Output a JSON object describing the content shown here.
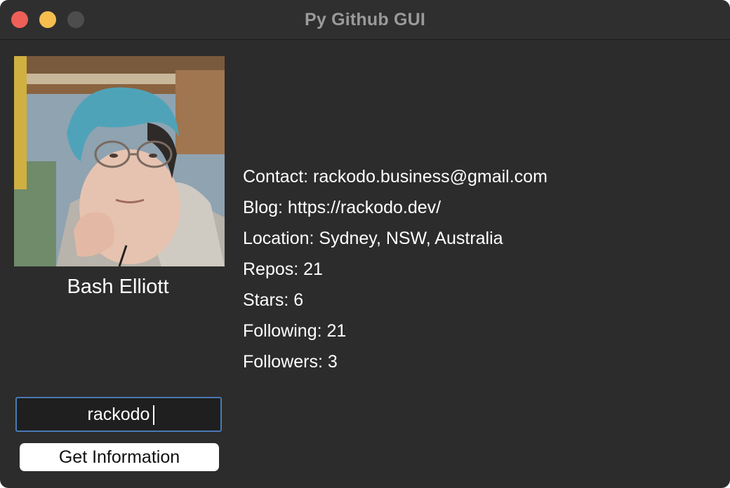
{
  "window": {
    "title": "Py Github GUI"
  },
  "profile": {
    "name": "Bash Elliott",
    "avatar_icon": "user-avatar-photo"
  },
  "info": {
    "contact": "Contact: rackodo.business@gmail.com",
    "blog": "Blog: https://rackodo.dev/",
    "location": "Location: Sydney, NSW, Australia",
    "repos": "Repos: 21",
    "stars": "Stars: 6",
    "following": "Following: 21",
    "followers": "Followers: 3"
  },
  "search": {
    "value": "rackodo"
  },
  "actions": {
    "get_info_label": "Get Information"
  },
  "colors": {
    "window_bg": "#2c2c2c",
    "close": "#ee5f57",
    "minimize": "#f5be4f",
    "maximize_disabled": "#4d4d4d",
    "input_border": "#4a79b5"
  }
}
